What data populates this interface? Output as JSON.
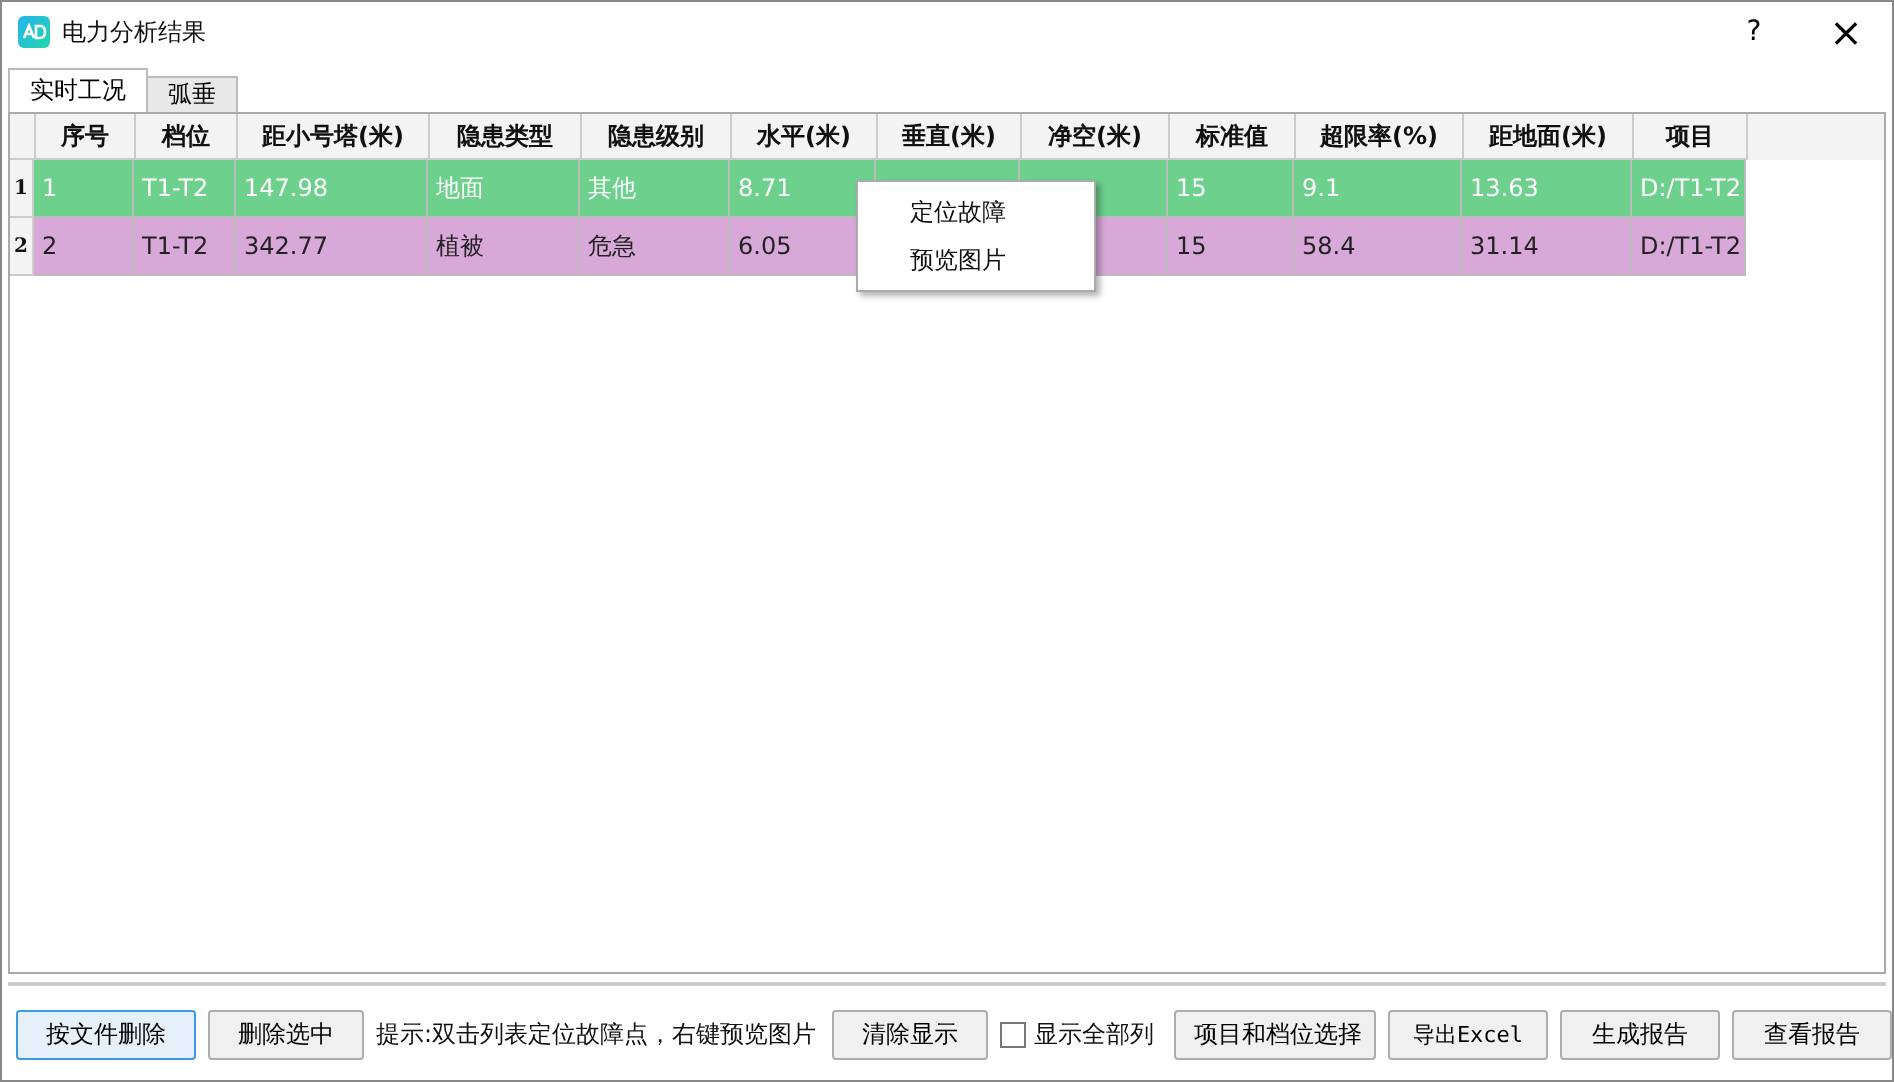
{
  "window": {
    "title": "电力分析结果",
    "help": "?",
    "close": "×"
  },
  "tabs": [
    {
      "label": "实时工况",
      "selected": true
    },
    {
      "label": "弧垂",
      "selected": false
    }
  ],
  "table": {
    "columns": [
      "序号",
      "档位",
      "距小号塔(米)",
      "隐患类型",
      "隐患级别",
      "水平(米)",
      "垂直(米)",
      "净空(米)",
      "标准值",
      "超限率(%)",
      "距地面(米)",
      "项目"
    ],
    "rows": [
      {
        "number": "1",
        "selected": true,
        "color": "#6dd08d",
        "cells": [
          "1",
          "T1-T2",
          "147.98",
          "地面",
          "其他",
          "8.71",
          "",
          "",
          "15",
          "9.1",
          "13.63",
          "D:/T1-T2"
        ]
      },
      {
        "number": "2",
        "selected": false,
        "color": "#d8a9d8",
        "cells": [
          "2",
          "T1-T2",
          "342.77",
          "植被",
          "危急",
          "6.05",
          "",
          "",
          "15",
          "58.4",
          "31.14",
          "D:/T1-T2"
        ]
      }
    ]
  },
  "context_menu": [
    "定位故障",
    "预览图片"
  ],
  "bottom_bar": {
    "buttons_left": [
      {
        "label": "按文件删除",
        "focused": true
      },
      {
        "label": "删除选中",
        "focused": false
      }
    ],
    "hint": "提示:双击列表定位故障点，右键预览图片",
    "clear_button": "清除显示",
    "show_all_columns": {
      "label": "显示全部列",
      "checked": false
    },
    "buttons_right": [
      "项目和档位选择",
      "导出Excel",
      "生成报告",
      "查看报告"
    ]
  }
}
